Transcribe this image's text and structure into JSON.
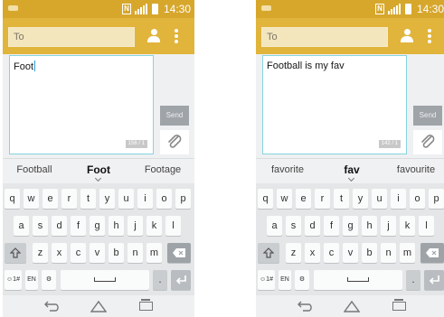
{
  "screens": [
    {
      "status": {
        "time": "14:30",
        "nfc": "N"
      },
      "header": {
        "to_placeholder": "To"
      },
      "compose": {
        "text": "Foot",
        "counter": "156 / 1"
      },
      "send_label": "Send",
      "suggestions": [
        "Football",
        "Foot",
        "Footage"
      ],
      "keyboard": {
        "row1": [
          "q",
          "w",
          "e",
          "r",
          "t",
          "y",
          "u",
          "i",
          "o",
          "p"
        ],
        "row2": [
          "a",
          "s",
          "d",
          "f",
          "g",
          "h",
          "j",
          "k",
          "l"
        ],
        "row3": [
          "z",
          "x",
          "c",
          "v",
          "b",
          "n",
          "m"
        ],
        "row4": [
          "☺1#",
          "EN",
          "⚙",
          "",
          "",
          "."
        ]
      }
    },
    {
      "status": {
        "time": "14:30",
        "nfc": "N"
      },
      "header": {
        "to_placeholder": "To"
      },
      "compose": {
        "text": "Football is my fav",
        "counter": "142 / 1"
      },
      "send_label": "Send",
      "suggestions": [
        "favorite",
        "fav",
        "favourite"
      ],
      "keyboard": {
        "row1": [
          "q",
          "w",
          "e",
          "r",
          "t",
          "y",
          "u",
          "i",
          "o",
          "p"
        ],
        "row2": [
          "a",
          "s",
          "d",
          "f",
          "g",
          "h",
          "j",
          "k",
          "l"
        ],
        "row3": [
          "z",
          "x",
          "c",
          "v",
          "b",
          "n",
          "m"
        ],
        "row4": [
          "☺1#",
          "EN",
          "⚙",
          "",
          "",
          "."
        ]
      }
    }
  ],
  "icons": {
    "contact": "contact-icon",
    "menu": "overflow-menu-icon",
    "attach": "paperclip-icon",
    "shift": "shift-icon",
    "backspace": "backspace-icon",
    "enter": "enter-icon",
    "back": "back-icon",
    "home": "home-icon",
    "recent": "recent-apps-icon"
  },
  "colors": {
    "accent": "#e1b43b",
    "status": "#d7a72c",
    "input_border": "#86d4df"
  }
}
